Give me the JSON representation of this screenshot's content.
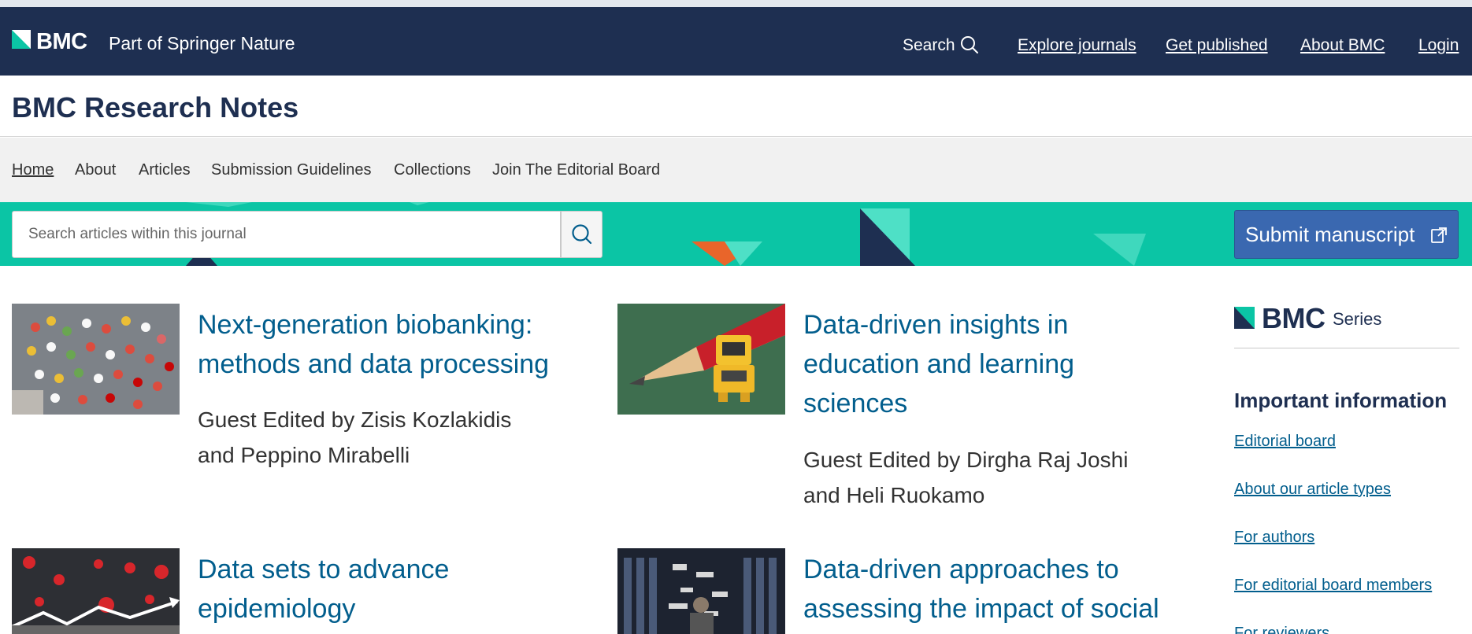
{
  "header": {
    "logo": "BMC",
    "tagline": "Part of Springer Nature",
    "search_label": "Search",
    "nav": [
      "Explore journals",
      "Get published",
      "About BMC",
      "Login"
    ]
  },
  "journal": {
    "title": "BMC Research Notes"
  },
  "subnav": [
    "Home",
    "About",
    "Articles",
    "Submission Guidelines",
    "Collections",
    "Join The Editorial Board"
  ],
  "search": {
    "placeholder": "Search articles within this journal"
  },
  "submit_button": "Submit manuscript",
  "collections": [
    {
      "title_lines": [
        "Next-generation biobanking:",
        "methods and data processing"
      ],
      "editor_lines": [
        "Guest Edited by Zisis Kozlakidis",
        "and Peppino Mirabelli"
      ]
    },
    {
      "title_lines": [
        "Data-driven insights in",
        "education and learning",
        "sciences"
      ],
      "editor_lines": [
        "Guest Edited by Dirgha Raj Joshi",
        "and Heli Ruokamo"
      ]
    },
    {
      "title_lines": [
        "Data sets to advance",
        "epidemiology"
      ]
    },
    {
      "title_lines": [
        "Data-driven approaches to",
        "assessing the impact of social"
      ]
    }
  ],
  "sidebar": {
    "series_logo": "BMC",
    "series_word": "Series",
    "heading": "Important information",
    "links": [
      "Editorial board",
      "About our article types",
      "For authors",
      "For editorial board members",
      "For reviewers"
    ]
  },
  "colors": {
    "navy": "#1e2f51",
    "teal": "#0bc5a5",
    "link_blue": "#025e8d",
    "button_blue": "#3a68b0"
  },
  "icons": [
    "bmc-logo-icon",
    "search-icon",
    "external-link-icon"
  ]
}
